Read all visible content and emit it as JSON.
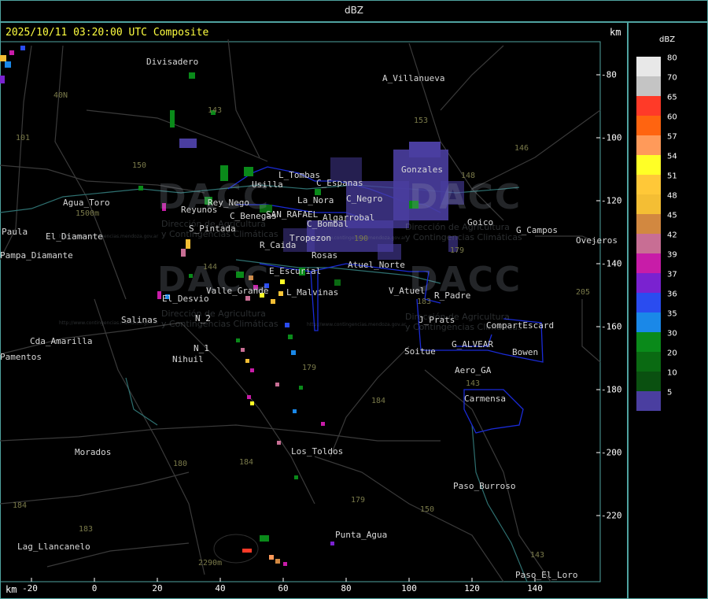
{
  "header": {
    "title": "dBZ"
  },
  "map": {
    "timestamp": "2025/10/11 03:20:00 UTC Composite",
    "unit_top": "km",
    "unit_bottom": "km",
    "x_ticks": [
      "-20",
      "0",
      "20",
      "40",
      "60",
      "80",
      "100",
      "120",
      "140"
    ],
    "y_ticks": [
      "-80",
      "-100",
      "-120",
      "-140",
      "-160",
      "-180",
      "-200",
      "-220"
    ],
    "places": [
      "Divisadero",
      "A_Villanueva",
      "101",
      "40N",
      "Agua_Toro",
      "1500m",
      "El_Diamante",
      "Paula",
      "Pampa_Diamante",
      "Usilla",
      "L_Tombas",
      "C_Espanas",
      "C_Negro",
      "Rey_Nego",
      "Reyunos",
      "C_Benegas",
      "SAN_RAFAEL",
      "Algarrobal",
      "La_Nora",
      "C_Bombal",
      "S_Pintada",
      "Tropezon",
      "R_Caida",
      "Rosas",
      "Atuel_Norte",
      "Gonzales",
      "Goico",
      "G_Campos",
      "Ovejeros",
      "E_Escurial",
      "El_Desvio",
      "Valle_Grande",
      "L_Malvinas",
      "V_Atuel",
      "R_Padre",
      "205",
      "Salinas",
      "N_2",
      "N_1",
      "Nihuil",
      "Cda_Amarilla",
      "Pamentos",
      "J_Prats",
      "CompartEscard",
      "G_ALVEAR",
      "Bowen",
      "Soitue",
      "Aero_GA",
      "Carmensa",
      "179",
      "184",
      "Morados",
      "Los_Toldos",
      "180",
      "184",
      "Paso_Burroso",
      "179",
      "150",
      "184",
      "183",
      "Lag_Llancanelo",
      "Punta_Agua",
      "2290m",
      "143",
      "Paso_El_Loro",
      "153",
      "146",
      "148",
      "150",
      "143",
      "144",
      "143",
      "183",
      "179",
      "190"
    ],
    "watermark": {
      "logo": "DACC",
      "subtitle_1": "Dirección de Agricultura",
      "subtitle_2": "y Contingencias Climáticas",
      "url": "http://www.contingencias.mendoza.gov.ar"
    },
    "colors": {
      "grid": "#4fa3a0",
      "boundary": "#1a2bd8",
      "roads": "#3a3a3a",
      "rivers": "#2f6f6f",
      "timestamp": "#ffff40"
    }
  },
  "legend": {
    "title": "dBZ",
    "bins": [
      {
        "label": "80",
        "color": "#e8e8e8"
      },
      {
        "label": "70",
        "color": "#c4c4c4"
      },
      {
        "label": "65",
        "color": "#ff3a28"
      },
      {
        "label": "60",
        "color": "#ff6410"
      },
      {
        "label": "57",
        "color": "#ff9a5a"
      },
      {
        "label": "54",
        "color": "#ffff26"
      },
      {
        "label": "51",
        "color": "#ffc838"
      },
      {
        "label": "48",
        "color": "#f4be34"
      },
      {
        "label": "45",
        "color": "#d28840"
      },
      {
        "label": "42",
        "color": "#c86e94"
      },
      {
        "label": "39",
        "color": "#c81ca8"
      },
      {
        "label": "37",
        "color": "#7a22d0"
      },
      {
        "label": "36",
        "color": "#2a4cf0"
      },
      {
        "label": "35",
        "color": "#1a88e8"
      },
      {
        "label": "30",
        "color": "#0a8a1a"
      },
      {
        "label": "20",
        "color": "#0a6a12"
      },
      {
        "label": "10",
        "color": "#0a5010"
      },
      {
        "label": "5",
        "color": "#4a3ea0"
      }
    ]
  }
}
